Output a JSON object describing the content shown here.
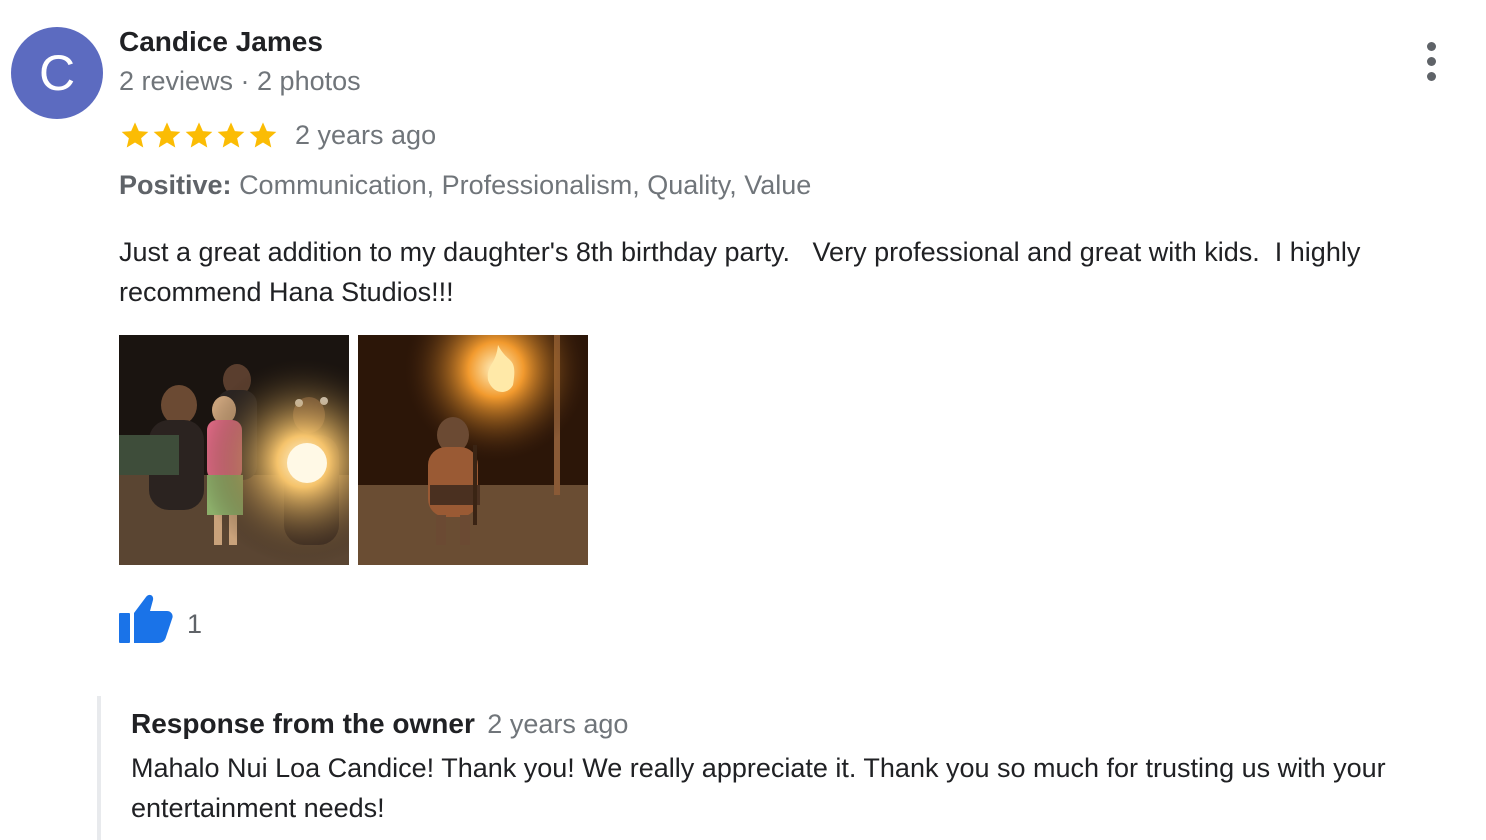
{
  "reviewer": {
    "avatar_letter": "C",
    "avatar_color": "#5c6bc0",
    "name": "Candice James",
    "meta": "2 reviews · 2 photos"
  },
  "menu": {
    "icon": "more-vert-icon"
  },
  "rating": {
    "stars": 5,
    "max_stars": 5,
    "star_color": "#fbbc04",
    "date": "2 years ago"
  },
  "attributes": {
    "label": "Positive:",
    "values": "Communication, Professionalism, Quality, Value"
  },
  "review": {
    "text": "Just a great addition to my daughter's 8th birthday party.   Very professional and great with kids.  I highly\nrecommend Hana Studios!!!"
  },
  "photos": [
    {
      "icon": "review-photo-1"
    },
    {
      "icon": "review-photo-2"
    }
  ],
  "like": {
    "icon": "thumbs-up-icon",
    "color": "#1a73e8",
    "count": "1"
  },
  "owner_response": {
    "title": "Response from the owner",
    "date": "2 years ago",
    "text": "Mahalo Nui Loa Candice! Thank you! We really appreciate it. Thank you so much for trusting us with your entertainment needs!"
  }
}
